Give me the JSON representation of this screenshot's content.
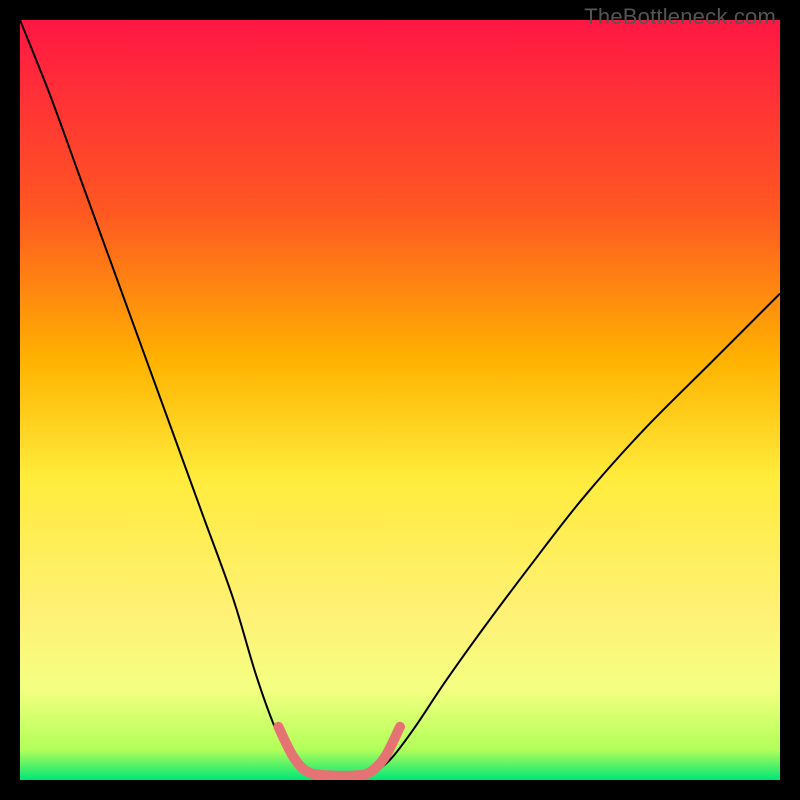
{
  "watermark": "TheBottleneck.com",
  "chart_data": {
    "type": "line",
    "title": "",
    "xlabel": "",
    "ylabel": "",
    "x_range": [
      0,
      100
    ],
    "y_range": [
      0,
      100
    ],
    "gradient_stops": [
      {
        "offset": 0,
        "color": "#ff1744"
      },
      {
        "offset": 25,
        "color": "#ff5722"
      },
      {
        "offset": 45,
        "color": "#ffb300"
      },
      {
        "offset": 60,
        "color": "#ffeb3b"
      },
      {
        "offset": 78,
        "color": "#fff176"
      },
      {
        "offset": 88,
        "color": "#f4ff81"
      },
      {
        "offset": 96,
        "color": "#b2ff59"
      },
      {
        "offset": 100,
        "color": "#00e676"
      }
    ],
    "series": [
      {
        "name": "left-curve",
        "color": "#000000",
        "width": 2,
        "x": [
          0,
          4,
          8,
          12,
          16,
          20,
          24,
          28,
          31,
          33.5,
          35.5,
          37
        ],
        "y": [
          100,
          90,
          79,
          68,
          57,
          46,
          35,
          24,
          14,
          7,
          3,
          1.2
        ]
      },
      {
        "name": "right-curve",
        "color": "#000000",
        "width": 2,
        "x": [
          47,
          49,
          52,
          56,
          61,
          67,
          74,
          82,
          91,
          100
        ],
        "y": [
          1.2,
          3,
          7,
          13,
          20,
          28,
          37,
          46,
          55,
          64
        ]
      },
      {
        "name": "bottom-bracket",
        "color": "#e57373",
        "width": 10,
        "linecap": "round",
        "x": [
          34,
          36,
          38,
          41,
          44,
          46,
          48,
          50
        ],
        "y": [
          7,
          3,
          1.0,
          0.6,
          0.6,
          1.0,
          3,
          7
        ]
      }
    ]
  }
}
